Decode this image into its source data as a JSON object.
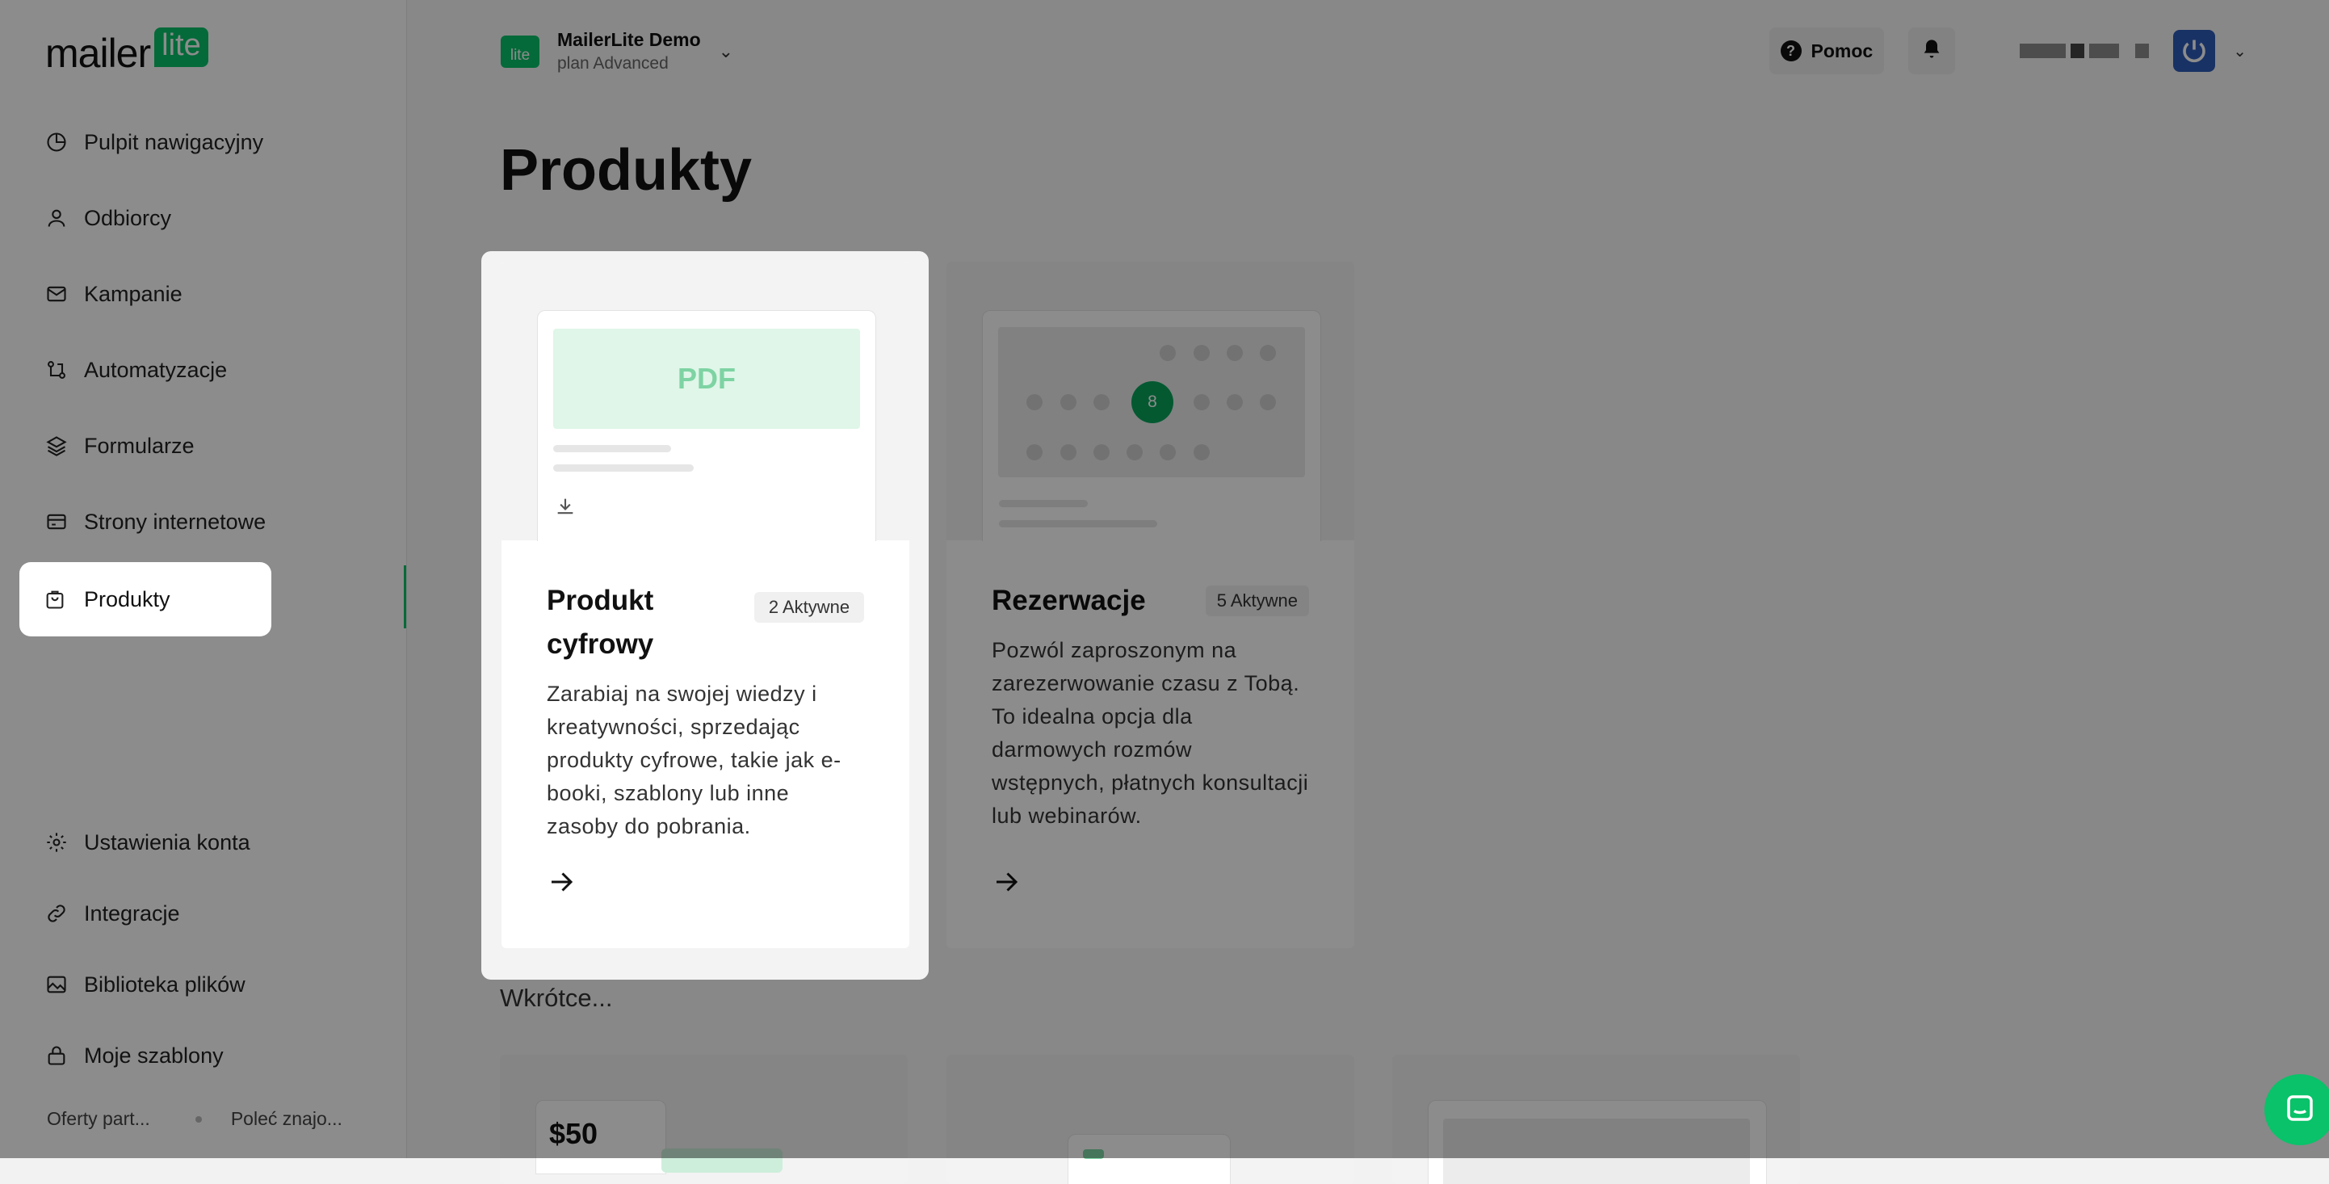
{
  "app": {
    "logo_word": "mailer",
    "logo_badge": "lite"
  },
  "sidebar": {
    "items": [
      {
        "label": "Pulpit nawigacyjny",
        "icon": "dashboard-icon"
      },
      {
        "label": "Odbiorcy",
        "icon": "user-icon"
      },
      {
        "label": "Kampanie",
        "icon": "mail-icon"
      },
      {
        "label": "Automatyzacje",
        "icon": "automation-icon"
      },
      {
        "label": "Formularze",
        "icon": "layers-icon"
      },
      {
        "label": "Strony internetowe",
        "icon": "browser-icon"
      },
      {
        "label": "Produkty",
        "icon": "bag-icon",
        "active": true
      }
    ],
    "bottom_items": [
      {
        "label": "Ustawienia konta",
        "icon": "gear-icon"
      },
      {
        "label": "Integracje",
        "icon": "link-icon"
      },
      {
        "label": "Biblioteka plików",
        "icon": "image-icon"
      },
      {
        "label": "Moje szablony",
        "icon": "lock-icon"
      }
    ],
    "footer": {
      "left": "Oferty part...",
      "right": "Poleć znajo..."
    }
  },
  "header": {
    "account_logo": "lite",
    "account_name": "MailerLite Demo",
    "account_plan": "plan Advanced",
    "help_label": "Pomoc"
  },
  "main": {
    "title": "Produkty",
    "cards": [
      {
        "title": "Produkt cyfrowy",
        "badge": "2 Aktywne",
        "preview_label": "PDF",
        "description": "Zarabiaj na swojej wiedzy i kreatywności, sprzedając produkty cyfrowe, takie jak e-booki, szablony lub inne zasoby do pobrania."
      },
      {
        "title": "Rezerwacje",
        "badge": "5 Aktywne",
        "selected_day": "8",
        "description": "Pozwól zaproszonym na zarezerwowanie czasu z Tobą. To idealna opcja dla darmowych rozmów wstępnych, płatnych konsultacji lub webinarów."
      }
    ],
    "coming_soon_label": "Wkrótce...",
    "coming_soon_price": "$50"
  },
  "colors": {
    "brand_green": "#09c269",
    "overlay": "rgba(0,0,0,0.45)",
    "avatar_blue": "#2e5bb8"
  }
}
